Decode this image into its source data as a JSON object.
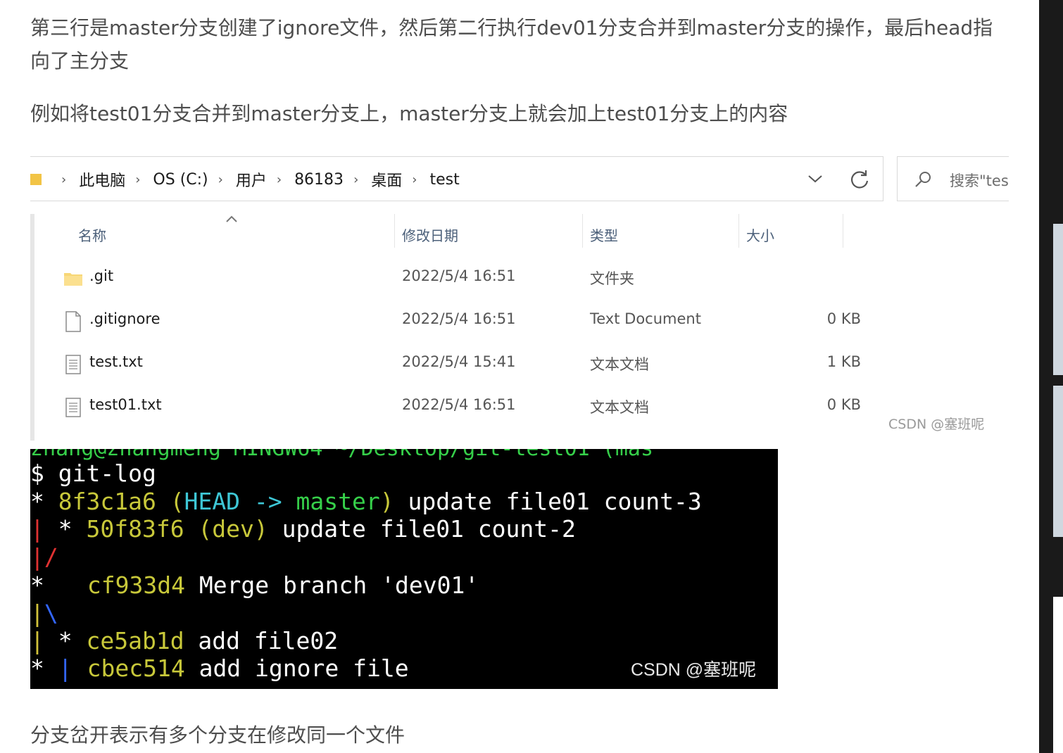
{
  "article": {
    "p1": "第三行是master分支创建了ignore文件，然后第二行执行dev01分支合并到master分支的操作，最后head指向了主分支",
    "p2": "例如将test01分支合并到master分支上，master分支上就会加上test01分支上的内容",
    "p3": "分支岔开表示有多个分支在修改同一个文件"
  },
  "explorer": {
    "breadcrumb": [
      "此电脑",
      "OS (C:)",
      "用户",
      "86183",
      "桌面",
      "test"
    ],
    "search_placeholder": "搜索\"tes",
    "columns": {
      "name": "名称",
      "date": "修改日期",
      "type": "类型",
      "size": "大小"
    },
    "files": [
      {
        "name": ".git",
        "date": "2022/5/4 16:51",
        "type": "文件夹",
        "size": "",
        "icon": "folder-icon"
      },
      {
        "name": ".gitignore",
        "date": "2022/5/4 16:51",
        "type": "Text Document",
        "size": "0 KB",
        "icon": "document-icon"
      },
      {
        "name": "test.txt",
        "date": "2022/5/4 15:41",
        "type": "文本文档",
        "size": "1 KB",
        "icon": "text-file-icon"
      },
      {
        "name": "test01.txt",
        "date": "2022/5/4 16:51",
        "type": "文本文档",
        "size": "0 KB",
        "icon": "text-file-icon"
      }
    ],
    "watermark": "CSDN @塞班呢"
  },
  "terminal": {
    "prompt_cut": "zhang@zhangmeng MINGW64 ~/Desktop/git-test01 (mas",
    "command": "$ git-log",
    "line1": {
      "star": "* ",
      "hash": "8f3c1a6",
      "refs_open": " (",
      "head": "HEAD",
      "arrow": " -> ",
      "branch": "master",
      "refs_close": ")",
      "msg": " update file01 count-3"
    },
    "line2": {
      "graph_bar": "|",
      "star": " * ",
      "hash": "50f83f6",
      "refs": " (dev)",
      "msg": " update file01 count-2"
    },
    "line3": {
      "graph": "|/"
    },
    "line4": {
      "star": "*",
      "hash": "cf933d4",
      "msg": " Merge branch 'dev01'"
    },
    "line5": {
      "graph": "|\\"
    },
    "line6": {
      "graph_bar": "|",
      "star": " * ",
      "hash": "ce5ab1d",
      "msg": " add file02"
    },
    "line7": {
      "star": "*",
      "graph_bar": " |",
      "hash": "cbec514",
      "msg": " add ignore file"
    },
    "watermark": "CSDN @塞班呢"
  },
  "colors": {
    "hash": "#c8c83a",
    "head": "#3ec7d6",
    "branch": "#36d04a",
    "graph_red": "#e03232",
    "graph_yellow": "#d2c23a",
    "graph_blue": "#3366ff",
    "folder": "#f2c446"
  }
}
